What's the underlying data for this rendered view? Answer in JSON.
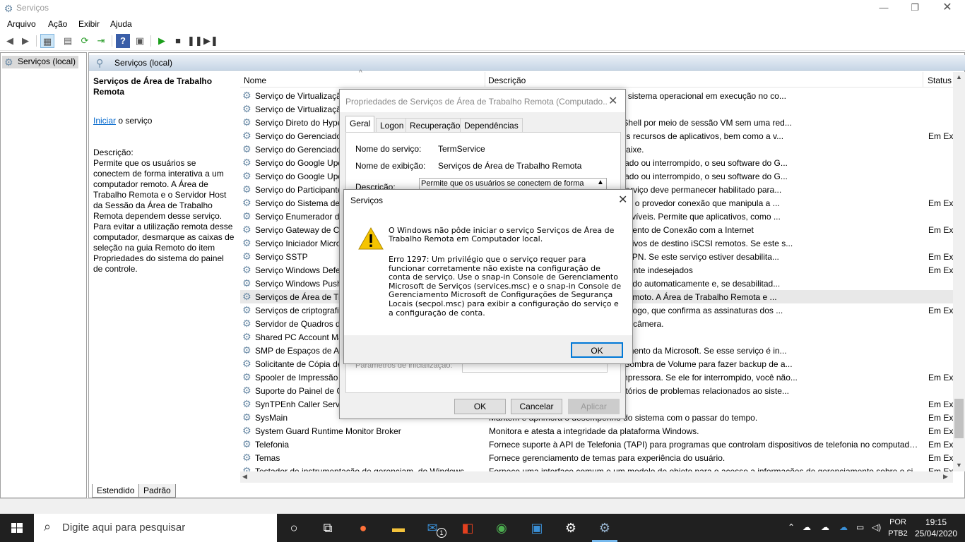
{
  "window": {
    "title": "Serviços"
  },
  "menu": [
    "Arquivo",
    "Ação",
    "Exibir",
    "Ajuda"
  ],
  "tree": {
    "root": "Serviços (local)"
  },
  "pane": {
    "header": "Serviços (local)",
    "service_title": "Serviços de Área de Trabalho Remota",
    "start_link": "Iniciar",
    "start_suffix": " o serviço",
    "desc_label": "Descrição:",
    "desc_text": "Permite que os usuários se conectem de forma interativa a um computador remoto. A Área de Trabalho Remota e o Servidor Host da Sessão da Área de Trabalho Remota dependem desse serviço. Para evitar a utilização remota desse computador, desmarque as caixas de seleção na guia Remoto do item Propriedades do sistema do painel de controle."
  },
  "list": {
    "columns": {
      "name": "Nome",
      "description": "Descrição",
      "status": "Status"
    },
    "rows": [
      {
        "name": "Serviço de Virtualização",
        "desc": "unicação entre a máquina virtual e o sistema operacional em execução no co...",
        "status": ""
      },
      {
        "name": "Serviço de Virtualização",
        "desc": "ede.",
        "status": ""
      },
      {
        "name": "Serviço Direto do Hype",
        "desc": "izar máquinas virtuais com o PowerShell por meio de sessão VM sem uma red...",
        "status": ""
      },
      {
        "name": "Serviço do Gerenciador",
        "desc": "o do acesso dos aplicativos UWP aos recursos de aplicativos, bem como a v...",
        "status": "Em Ex"
      },
      {
        "name": "Serviço do Gerenciador",
        "desc": "em fio, incluindo vídeo sem fio e encaixe.",
        "status": ""
      },
      {
        "name": "Serviço do Google Upd",
        "desc": "ualizado. Se este serviço for desativado ou interrompido, o seu software do G...",
        "status": ""
      },
      {
        "name": "Serviço do Google Upd",
        "desc": "ualizado. Se este serviço for desativado ou interrompido, o seu software do G...",
        "status": ""
      },
      {
        "name": "Serviço do Participante",
        "desc": "o Programa Windows Insider. Este serviço deve permanecer habilitado para...",
        "status": ""
      },
      {
        "name": "Serviço do Sistema de",
        "desc": "hospeda a plataforma de notificação e o provedor conexão que manipula a ...",
        "status": "Em Ex"
      },
      {
        "name": "Serviço Enumerador de",
        "desc": "s de armazenamento em massa removíveis. Permite que aplicativos, como ...",
        "status": ""
      },
      {
        "name": "Serviço Gateway de Ca",
        "desc": "colo de terceiros para o Compartilhamento de Conexão com a Internet",
        "status": "Em Ex"
      },
      {
        "name": "Serviço Iniciador Micro",
        "desc": "SCSI) deste computador para dispositivos de destino iSCSI remotos. Se este s...",
        "status": ""
      },
      {
        "name": "Serviço SSTP",
        "desc": "se a computadores remotos usando VPN. Se este serviço estiver desabilita...",
        "status": "Em Ex"
      },
      {
        "name": "Serviço Windows Defer",
        "desc": "alware e outros softwares potencialmente indesejados",
        "status": "Em Ex"
      },
      {
        "name": "Serviço Windows Push",
        "desc": "a Microsoft Store. Este serviço é iniciado automaticamente e, se desabilitad...",
        "status": ""
      },
      {
        "name": "Serviços de Área de Tra",
        "desc": "e forma interativa a um computador remoto. A Área de Trabalho Remota e ...",
        "status": ""
      },
      {
        "name": "Serviços de criptografi",
        "desc": ": Serviço de Banco de Dados de Catálogo, que confirma as assinaturas dos ...",
        "status": "Em Ex"
      },
      {
        "name": "Servidor de Quadros de",
        "desc": "quadros de vídeo de dispositivos com câmera.",
        "status": ""
      },
      {
        "name": "Shared PC Account Ma",
        "desc": "aredPC configured device",
        "status": ""
      },
      {
        "name": "SMP de Espaços de Arr",
        "desc": "nciamento de Espaços de Armazenamento da Microsoft. Se esse serviço é in...",
        "status": ""
      },
      {
        "name": "Solicitante de Cópia de",
        "desc": "as para usar o Serviço de Cópia de Sombra de Volume para fazer backup de a...",
        "status": ""
      },
      {
        "name": "Spooler de Impressão",
        "desc": "mpressão e faz a interação com a impressora. Se ele for interrompido, você não...",
        "status": "Em Ex"
      },
      {
        "name": "Suporte do Painel de C",
        "desc": "xibição, o envio e a exclusão de relatórios de problemas relacionados ao siste...",
        "status": ""
      },
      {
        "name": "SynTPEnh Caller Servic",
        "desc": "",
        "status": "Em Ex"
      },
      {
        "name": "SysMain",
        "desc": "Mantém e aprimora o desempenho do sistema com o passar do tempo.",
        "status": "Em Ex"
      },
      {
        "name": "System Guard Runtime Monitor Broker",
        "desc": "Monitora e atesta a integridade da plataforma Windows.",
        "status": "Em Ex"
      },
      {
        "name": "Telefonia",
        "desc": "Fornece suporte à API de Telefonia (TAPI) para programas que controlam dispositivos de telefonia no computador ...",
        "status": "Em Ex"
      },
      {
        "name": "Temas",
        "desc": "Fornece gerenciamento de temas para experiência do usuário.",
        "status": "Em Ex"
      },
      {
        "name": "Testador de instrumentação de gerenciam. do Windows",
        "desc": "Fornece uma interface comum e um modelo de objeto para o acesso a informações de gerenciamento sobre o si...",
        "status": "Em Ex"
      }
    ]
  },
  "bottom_tabs": [
    "Estendido",
    "Padrão"
  ],
  "properties": {
    "title": "Propriedades de Serviços de Área de Trabalho Remota (Computado...",
    "tabs": [
      "Geral",
      "Logon",
      "Recuperação",
      "Dependências"
    ],
    "service_name_label": "Nome do serviço:",
    "service_name": "TermService",
    "display_name_label": "Nome de exibição:",
    "display_name": "Serviços de Área de Trabalho Remota",
    "description_label": "Descrição:",
    "description_value": "Permite que os usuários se conectem de forma",
    "params_label": "Parâmetros de inicialização:",
    "ok": "OK",
    "cancel": "Cancelar",
    "apply": "Aplicar"
  },
  "error": {
    "title": "Serviços",
    "line1": "O Windows não pôde iniciar o serviço Serviços de Área de Trabalho Remota em Computador local.",
    "line2": "Erro 1297: Um privilégio que o serviço requer para funcionar corretamente não existe na configuração de conta de serviço. Use o snap-in Console de Gerenciamento Microsoft de Serviços (services.msc) e o snap-in Console de Gerenciamento Microsoft de Configurações de Segurança Locais (secpol.msc) para exibir a configuração do serviço e a configuração de conta.",
    "ok": "OK"
  },
  "taskbar": {
    "search_placeholder": "Digite aqui para pesquisar",
    "mail_badge": "1",
    "lang_top": "POR",
    "lang_bottom": "PTB2",
    "time": "19:15",
    "date": "25/04/2020"
  },
  "colors": {
    "accent": "#0078d7",
    "warning": "#f5c400",
    "taskbar": "#202020"
  }
}
